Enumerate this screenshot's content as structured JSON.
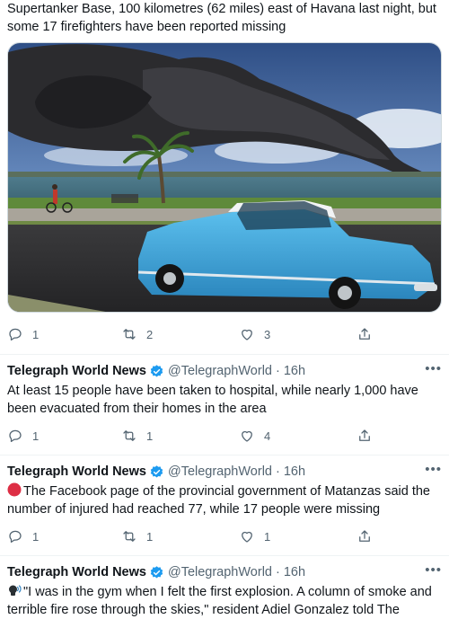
{
  "first_tweet": {
    "text_tail": "Supertanker Base, 100 kilometres (62 miles) east of Havana last night, but some 17 firefighters have been reported missing",
    "actions": {
      "replies": "1",
      "retweets": "2",
      "likes": "3"
    }
  },
  "tweets": [
    {
      "name": "Telegraph World News",
      "handle": "@TelegraphWorld",
      "time": "16h",
      "text": "At least 15 people have been taken to hospital, while nearly 1,000 have been evacuated from their homes in the area",
      "replies": "1",
      "retweets": "1",
      "likes": "4"
    },
    {
      "name": "Telegraph World News",
      "handle": "@TelegraphWorld",
      "time": "16h",
      "emoji": "red-circle",
      "text": "The Facebook page of the provincial government of Matanzas said the number of injured had reached 77, while 17 people were missing",
      "replies": "1",
      "retweets": "1",
      "likes": "1"
    },
    {
      "name": "Telegraph World News",
      "handle": "@TelegraphWorld",
      "time": "16h",
      "emoji": "speaking-head",
      "text": "\"I was in the gym when I felt the first explosion. A column of smoke and terrible fire rose through the skies,\" resident Adiel Gonzalez told The"
    }
  ],
  "colors": {
    "verified": "#1d9bf0",
    "muted": "#536471",
    "text": "#0f1419",
    "car": "#3aa3d8"
  },
  "icons": [
    "reply-icon",
    "retweet-icon",
    "like-icon",
    "share-icon",
    "verified-badge-icon",
    "more-icon"
  ]
}
